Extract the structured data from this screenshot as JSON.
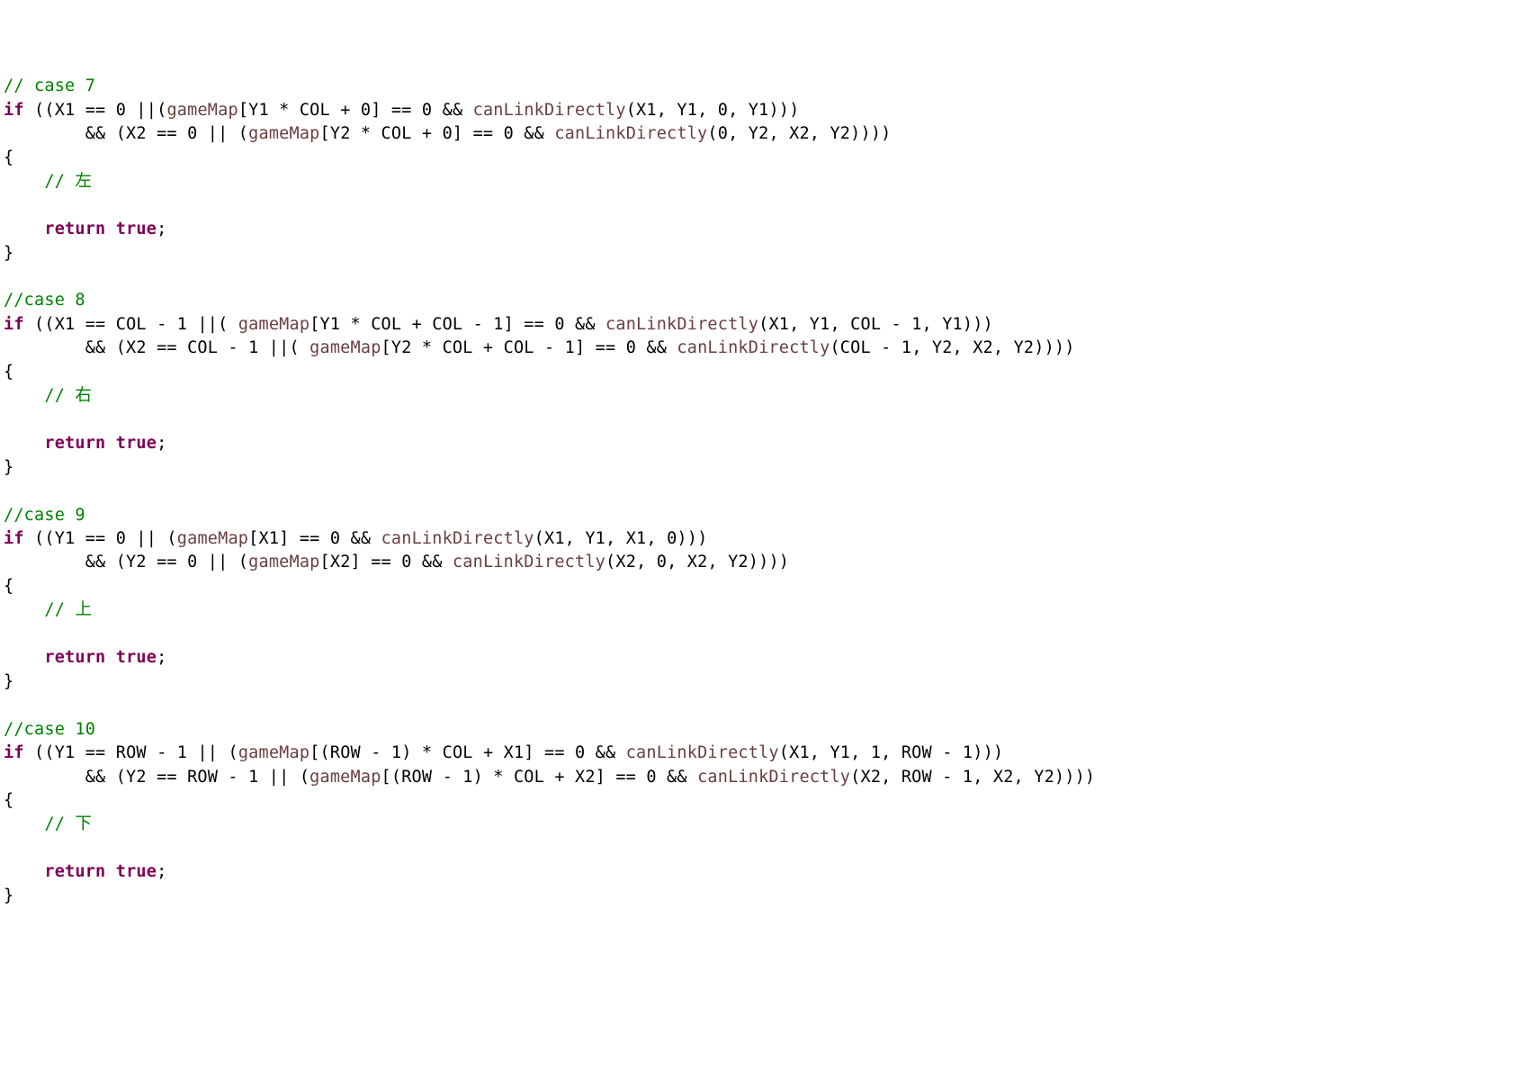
{
  "lines": {
    "l1_c": "// case 7",
    "l2_kw": "if",
    "l2_a": " ((X1 == ",
    "l2_b": "0",
    "l2_c": " ||(",
    "l2_id1": "gameMap",
    "l2_d": "[Y1 * COL + ",
    "l2_e": "0",
    "l2_f": "] == ",
    "l2_g": "0",
    "l2_h": " && ",
    "l2_id2": "canLinkDirectly",
    "l2_i": "(X1, Y1, ",
    "l2_j": "0",
    "l2_k": ", Y1)))",
    "l3_a": "        && (X2 == ",
    "l3_b": "0",
    "l3_c": " || (",
    "l3_id1": "gameMap",
    "l3_d": "[Y2 * COL + ",
    "l3_e": "0",
    "l3_f": "] == ",
    "l3_g": "0",
    "l3_h": " && ",
    "l3_id2": "canLinkDirectly",
    "l3_i": "(",
    "l3_j": "0",
    "l3_k": ", Y2, X2, Y2))))",
    "l4": "{",
    "l5_c": "    // 左",
    "l6": "",
    "l7_a": "    ",
    "l7_kw": "return",
    "l7_b": " ",
    "l7_tr": "true",
    "l7_c": ";",
    "l8": "}",
    "l9": "",
    "l10_c": "//case 8",
    "l11_kw": "if",
    "l11_a": " ((X1 == COL - ",
    "l11_b": "1",
    "l11_c": " ||( ",
    "l11_id1": "gameMap",
    "l11_d": "[Y1 * COL + COL - ",
    "l11_e": "1",
    "l11_f": "] == ",
    "l11_g": "0",
    "l11_h": " && ",
    "l11_id2": "canLinkDirectly",
    "l11_i": "(X1, Y1, COL - ",
    "l11_j": "1",
    "l11_k": ", Y1)))",
    "l12_a": "        && (X2 == COL - ",
    "l12_b": "1",
    "l12_c": " ||( ",
    "l12_id1": "gameMap",
    "l12_d": "[Y2 * COL + COL - ",
    "l12_e": "1",
    "l12_f": "] == ",
    "l12_g": "0",
    "l12_h": " && ",
    "l12_id2": "canLinkDirectly",
    "l12_i": "(COL - ",
    "l12_j": "1",
    "l12_k": ", Y2, X2, Y2))))",
    "l13": "{",
    "l14_c": "    // 右",
    "l15": "",
    "l16_a": "    ",
    "l16_kw": "return",
    "l16_b": " ",
    "l16_tr": "true",
    "l16_c": ";",
    "l17": "}",
    "l18": "",
    "l19_c": "//case 9",
    "l20_kw": "if",
    "l20_a": " ((Y1 == ",
    "l20_b": "0",
    "l20_c": " || (",
    "l20_id1": "gameMap",
    "l20_d": "[X1] == ",
    "l20_e": "0",
    "l20_f": " && ",
    "l20_id2": "canLinkDirectly",
    "l20_g": "(X1, Y1, X1, ",
    "l20_h": "0",
    "l20_i": ")))",
    "l21_a": "        && (Y2 == ",
    "l21_b": "0",
    "l21_c": " || (",
    "l21_id1": "gameMap",
    "l21_d": "[X2] == ",
    "l21_e": "0",
    "l21_f": " && ",
    "l21_id2": "canLinkDirectly",
    "l21_g": "(X2, ",
    "l21_h": "0",
    "l21_i": ", X2, Y2))))",
    "l22": "{",
    "l23_c": "    // 上",
    "l24": "",
    "l25_a": "    ",
    "l25_kw": "return",
    "l25_b": " ",
    "l25_tr": "true",
    "l25_c": ";",
    "l26": "}",
    "l27": "",
    "l28_c": "//case 10",
    "l29_kw": "if",
    "l29_a": " ((Y1 == ROW - ",
    "l29_b": "1",
    "l29_c": " || (",
    "l29_id1": "gameMap",
    "l29_d": "[(ROW - ",
    "l29_e": "1",
    "l29_f": ") * COL + X1] == ",
    "l29_g": "0",
    "l29_h": " && ",
    "l29_id2": "canLinkDirectly",
    "l29_i": "(X1, Y1, ",
    "l29_j": "1",
    "l29_k": ", ROW - ",
    "l29_l": "1",
    "l29_m": ")))",
    "l30_a": "        && (Y2 == ROW - ",
    "l30_b": "1",
    "l30_c": " || (",
    "l30_id1": "gameMap",
    "l30_d": "[(ROW - ",
    "l30_e": "1",
    "l30_f": ") * COL + X2] == ",
    "l30_g": "0",
    "l30_h": " && ",
    "l30_id2": "canLinkDirectly",
    "l30_i": "(X2, ROW - ",
    "l30_j": "1",
    "l30_k": ", X2, Y2))))",
    "l31": "{",
    "l32_c": "    // 下",
    "l33": "",
    "l34_a": "    ",
    "l34_kw": "return",
    "l34_b": " ",
    "l34_tr": "true",
    "l34_c": ";",
    "l35": "}"
  }
}
